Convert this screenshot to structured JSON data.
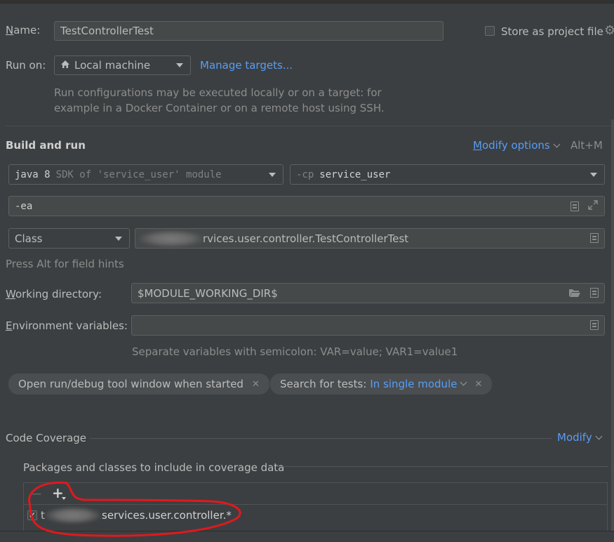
{
  "name": {
    "label": "Name:",
    "value": "TestControllerTest"
  },
  "store_as_project_file": {
    "label": "Store as project file",
    "checked": false
  },
  "run_on": {
    "label": "Run on:",
    "selected": "Local machine",
    "manage_link": "Manage targets...",
    "description_line1": "Run configurations may be executed locally or on a target: for",
    "description_line2": "example in a Docker Container or on a remote host using SSH."
  },
  "build_and_run": {
    "heading": "Build and run",
    "modify_options": "Modify options",
    "shortcut": "Alt+M",
    "jdk_bold": "java 8",
    "jdk_hint": "SDK of 'service_user' module",
    "cp_prefix": "-cp",
    "cp_value": "service_user",
    "vm_options": "-ea",
    "kind": "Class",
    "class_value": "rvices.user.controller.TestControllerTest",
    "field_hint": "Press Alt for field hints"
  },
  "working_directory": {
    "label": "Working directory:",
    "value": "$MODULE_WORKING_DIR$"
  },
  "env_vars": {
    "label": "Environment variables:",
    "value": "",
    "hint": "Separate variables with semicolon: VAR=value; VAR1=value1"
  },
  "options": {
    "open_tool_window": "Open run/debug tool window when started",
    "search_for_tests_label": "Search for tests:",
    "search_for_tests_value": "In single module"
  },
  "code_coverage": {
    "heading": "Code Coverage",
    "modify": "Modify",
    "packages_heading": "Packages and classes to include in coverage data",
    "entries": [
      {
        "checked": true,
        "prefix": "t",
        "value": "services.user.controller.*"
      }
    ]
  },
  "colors": {
    "accent": "#589df6",
    "background": "#3c3f41",
    "annotation": "#e0191e"
  }
}
